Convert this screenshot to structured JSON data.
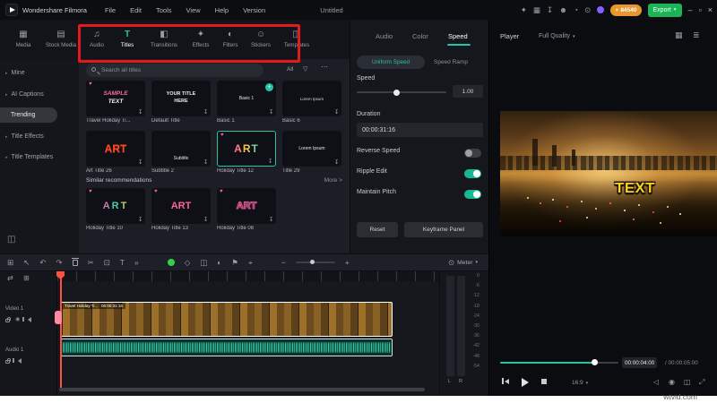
{
  "colors": {
    "accent": "#23c4a4",
    "export_green": "#1bb456",
    "badge_orange": "#e8962e",
    "annotation_red": "#e11b1b",
    "playhead_red": "#ff5044"
  },
  "icons": {
    "dropdown_caret": "▾",
    "chevron_right": "▸",
    "more_horizontal": "⋯",
    "funnel": "▽",
    "minimize": "–",
    "maximize": "▫",
    "close": "×",
    "gift": "✦",
    "layout": "▦",
    "download": "↧",
    "user": "☻",
    "bell": "◔",
    "screen_record": "⊙",
    "grid": "⊞",
    "select": "↖",
    "undo": "↶",
    "redo": "↷",
    "split": "✂",
    "crop": "⊡",
    "text_tool": "T",
    "more_tools": "»",
    "keyframe": "◇",
    "pip": "◫",
    "mask": "◐",
    "marker": "⚑",
    "motion_track": "⌖",
    "minus": "−",
    "plus": "+",
    "link": "⇄",
    "add_track": "⊞",
    "eye": "◉",
    "panel_collapse": "◫",
    "panel_grid": "▦",
    "adjust": "≣",
    "snapshot": "◉",
    "mini_player": "◫",
    "fullscreen": "⤢",
    "volume": "◁",
    "coin": "●",
    "heart": "♥"
  },
  "titlebar": {
    "app_name": "Wondershare Filmora",
    "menus": [
      {
        "label": "File"
      },
      {
        "label": "Edit"
      },
      {
        "label": "Tools"
      },
      {
        "label": "View"
      },
      {
        "label": "Help"
      },
      {
        "label": "Version"
      }
    ],
    "project_name": "Untitled",
    "points": "84540",
    "export_label": "Export"
  },
  "media_tabs": {
    "active": "Titles",
    "items": [
      {
        "label": "Media",
        "icon": "▦"
      },
      {
        "label": "Stock Media",
        "icon": "▤"
      },
      {
        "label": "Audio",
        "icon": "♫"
      },
      {
        "label": "Titles",
        "icon": "T"
      },
      {
        "label": "Transitions",
        "icon": "◧"
      },
      {
        "label": "Effects",
        "icon": "✦"
      },
      {
        "label": "Filters",
        "icon": "◐"
      },
      {
        "label": "Stickers",
        "icon": "☺"
      },
      {
        "label": "Templates",
        "icon": "◫"
      }
    ]
  },
  "sidebar": {
    "active": "Trending",
    "items": [
      {
        "label": "Mine"
      },
      {
        "label": "AI Captions"
      },
      {
        "label": "Trending"
      },
      {
        "label": "Title Effects"
      },
      {
        "label": "Title Templates"
      }
    ]
  },
  "library": {
    "search_placeholder": "Search all titles",
    "filter_all": "All",
    "selected": "Holiday Title 12",
    "items": [
      {
        "name": "Travel Holiday Ti...",
        "preview": "SAMPLE TEXT"
      },
      {
        "name": "Default Title",
        "preview": "YOUR TITLE HERE"
      },
      {
        "name": "Basic 1",
        "preview": "Basic 1"
      },
      {
        "name": "Basic 6",
        "preview": "Lorem Ipsum"
      },
      {
        "name": "Art Title 26",
        "preview": "ART"
      },
      {
        "name": "Subtitle 2",
        "preview": "Subtitle"
      },
      {
        "name": "Holiday Title 12",
        "preview": "ART"
      },
      {
        "name": "Title 29",
        "preview": "Lorem Ipsum"
      }
    ],
    "recommendations_title": "Similar recommendations",
    "more_label": "More >",
    "recommendations": [
      {
        "name": "Holiday Title 10",
        "preview": "ART"
      },
      {
        "name": "Holiday Title 13",
        "preview": "ART"
      },
      {
        "name": "Holiday Title 08",
        "preview": "ART"
      }
    ]
  },
  "properties": {
    "tabs": [
      {
        "label": "Audio"
      },
      {
        "label": "Color"
      },
      {
        "label": "Speed"
      }
    ],
    "active_tab": "Speed",
    "modes": [
      {
        "label": "Uniform Speed"
      },
      {
        "label": "Speed Ramp"
      }
    ],
    "active_mode": "Uniform Speed",
    "speed_label": "Speed",
    "speed_value": "1.00",
    "duration_label": "Duration",
    "duration_value": "00:00:31:16",
    "toggles": [
      {
        "label": "Reverse Speed",
        "state": "off"
      },
      {
        "label": "Ripple Edit",
        "state": "on"
      },
      {
        "label": "Maintain Pitch",
        "state": "on"
      }
    ],
    "reset_label": "Reset",
    "keyframe_label": "Keyframe Panel"
  },
  "player": {
    "title": "Player",
    "quality": "Full Quality",
    "overlay_text": "TEXT",
    "current_time": "00:00:04:00",
    "total_time": "/ 00:00:05:00",
    "aspect_ratio": "16:9",
    "progress_percent": 80
  },
  "timeline": {
    "meter_label": "Meter",
    "clip_label": "Travel Holiday Ti...",
    "clip_duration": "00:00:31:16",
    "tracks": [
      {
        "label": "Video 1"
      },
      {
        "label": "Audio 1"
      }
    ],
    "meter_scale": [
      {
        "v": "0"
      },
      {
        "v": "-6"
      },
      {
        "v": "-12"
      },
      {
        "v": "-18"
      },
      {
        "v": "-24"
      },
      {
        "v": "-30"
      },
      {
        "v": "-36"
      },
      {
        "v": "-42"
      },
      {
        "v": "-48"
      },
      {
        "v": "-54"
      }
    ],
    "channels": [
      {
        "label": "L"
      },
      {
        "label": "R"
      }
    ]
  },
  "watermark": "wtvid.com"
}
